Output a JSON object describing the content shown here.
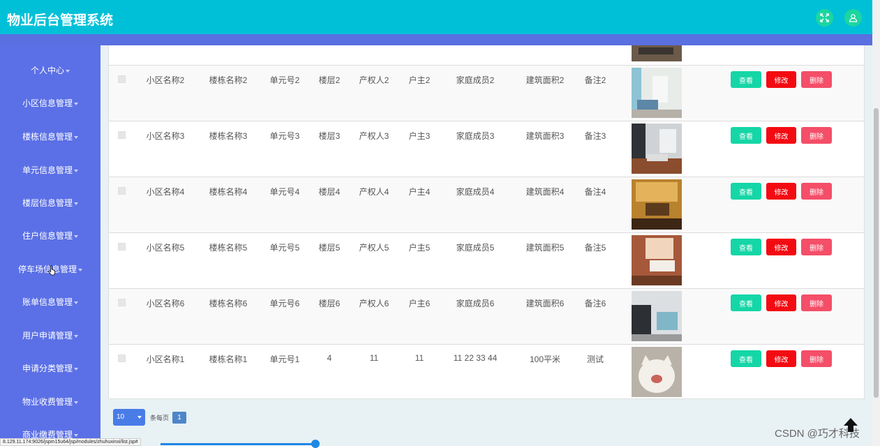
{
  "header": {
    "title": "物业后台管理系统"
  },
  "icons": {
    "fullscreen": "expand-icon",
    "user": "user-icon"
  },
  "sidebar": {
    "items": [
      {
        "label": "个人中心"
      },
      {
        "label": "小区信息管理"
      },
      {
        "label": "楼栋信息管理"
      },
      {
        "label": "单元信息管理"
      },
      {
        "label": "楼层信息管理"
      },
      {
        "label": "住户信息管理"
      },
      {
        "label": "停车场信息管理"
      },
      {
        "label": "账单信息管理"
      },
      {
        "label": "用户申请管理"
      },
      {
        "label": "申请分类管理"
      },
      {
        "label": "物业收费管理"
      },
      {
        "label": "商业缴费管理"
      }
    ]
  },
  "actions": {
    "view": "查看",
    "edit": "修改",
    "delete": "删除"
  },
  "table": {
    "rows": [
      {
        "community": "小区名称2",
        "building": "楼栋名称2",
        "unit": "单元号2",
        "floor": "楼层2",
        "owner": "产权人2",
        "householder": "户主2",
        "members": "家庭成员2",
        "area": "建筑面积2",
        "note": "备注2",
        "photo": "living-room-photo"
      },
      {
        "community": "小区名称3",
        "building": "楼栋名称3",
        "unit": "单元号3",
        "floor": "楼层3",
        "owner": "产权人3",
        "householder": "户主3",
        "members": "家庭成员3",
        "area": "建筑面积3",
        "note": "备注3",
        "photo": "living-room-photo"
      },
      {
        "community": "小区名称4",
        "building": "楼栋名称4",
        "unit": "单元号4",
        "floor": "楼层4",
        "owner": "产权人4",
        "householder": "户主4",
        "members": "家庭成员4",
        "area": "建筑面积4",
        "note": "备注4",
        "photo": "living-room-photo"
      },
      {
        "community": "小区名称5",
        "building": "楼栋名称5",
        "unit": "单元号5",
        "floor": "楼层5",
        "owner": "产权人5",
        "householder": "户主5",
        "members": "家庭成员5",
        "area": "建筑面积5",
        "note": "备注5",
        "photo": "bedroom-photo"
      },
      {
        "community": "小区名称6",
        "building": "楼栋名称6",
        "unit": "单元号6",
        "floor": "楼层6",
        "owner": "产权人6",
        "householder": "户主6",
        "members": "家庭成员6",
        "area": "建筑面积6",
        "note": "备注6",
        "photo": "loft-photo"
      },
      {
        "community": "小区名称1",
        "building": "楼栋名称1",
        "unit": "单元号1",
        "floor": "4",
        "owner": "11",
        "householder": "11",
        "members": "11 22 33 44",
        "area": "100平米",
        "note": "测试",
        "photo": "cat-photo"
      }
    ]
  },
  "pagination": {
    "page_size": "10",
    "per_page_label": "条每页",
    "current_page": "1"
  },
  "status_url": "8.129.11.174:9026/jspm15u64/jsp/modules/zhuhuxinxi/list.jsp#",
  "watermark": "CSDN @巧才科技",
  "colors": {
    "header": "#00c0d8",
    "sidebar": "#5b70e6",
    "view": "#14d6a6",
    "edit": "#f30b12",
    "delete": "#f44e68"
  }
}
